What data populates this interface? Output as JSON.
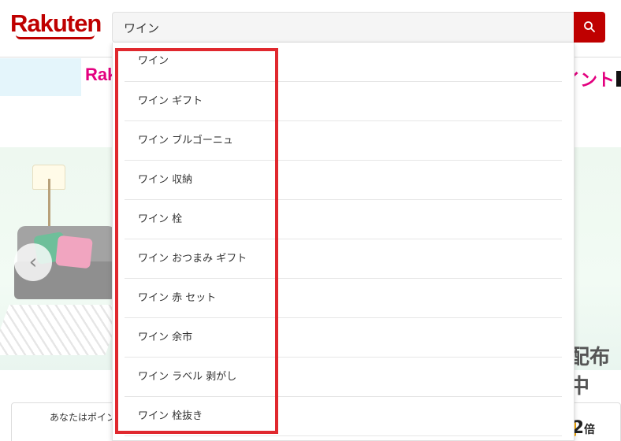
{
  "header": {
    "logo_text": "Rakuten",
    "search": {
      "value": "ワイン"
    },
    "search_button_icon": "search-icon"
  },
  "background": {
    "banner_partial": "Rak",
    "banner_right": "イント",
    "hero_text": "配布中",
    "points_label": "あなたはポイン",
    "bonus_prefix": "+",
    "bonus_number": "2",
    "bonus_suffix": "倍"
  },
  "suggestions": [
    "ワイン",
    "ワイン ギフト",
    "ワイン ブルゴーニュ",
    "ワイン 収納",
    "ワイン 栓",
    "ワイン おつまみ ギフト",
    "ワイン 赤 セット",
    "ワイン 余市",
    "ワイン ラベル 剥がし",
    "ワイン 栓抜き"
  ],
  "colors": {
    "brand": "#bf0000",
    "highlight": "#e0282e"
  }
}
